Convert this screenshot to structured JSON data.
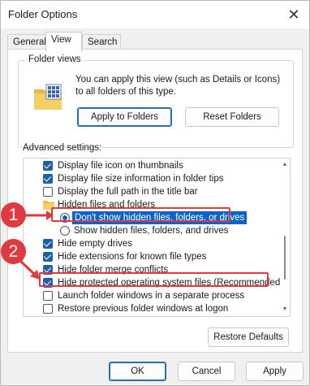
{
  "window": {
    "title": "Folder Options",
    "close_glyph": "✕"
  },
  "tabs": [
    {
      "label": "General",
      "active": false
    },
    {
      "label": "View",
      "active": true
    },
    {
      "label": "Search",
      "active": false
    }
  ],
  "folder_views": {
    "legend": "Folder views",
    "description": "You can apply this view (such as Details or Icons) to all folders of this type.",
    "apply_label": "Apply to Folders",
    "reset_label": "Reset Folders",
    "icon": "folder-grid-icon"
  },
  "advanced": {
    "label": "Advanced settings:",
    "items": [
      {
        "kind": "checkbox",
        "checked": true,
        "label": "Display file icon on thumbnails"
      },
      {
        "kind": "checkbox",
        "checked": true,
        "label": "Display file size information in folder tips"
      },
      {
        "kind": "checkbox",
        "checked": false,
        "label": "Display the full path in the title bar"
      },
      {
        "kind": "folder",
        "label": "Hidden files and folders"
      },
      {
        "kind": "radio",
        "checked": true,
        "label": "Don't show hidden files, folders, or drives"
      },
      {
        "kind": "radio",
        "checked": false,
        "label": "Show hidden files, folders, and drives"
      },
      {
        "kind": "checkbox",
        "checked": true,
        "label": "Hide empty drives"
      },
      {
        "kind": "checkbox",
        "checked": true,
        "label": "Hide extensions for known file types"
      },
      {
        "kind": "checkbox",
        "checked": true,
        "label": "Hide folder merge conflicts"
      },
      {
        "kind": "checkbox",
        "checked": true,
        "label": "Hide protected operating system files (Recommended)"
      },
      {
        "kind": "checkbox",
        "checked": false,
        "label": "Launch folder windows in a separate process"
      },
      {
        "kind": "checkbox",
        "checked": false,
        "label": "Restore previous folder windows at logon"
      }
    ]
  },
  "restore_defaults_label": "Restore Defaults",
  "footer": {
    "ok": "OK",
    "cancel": "Cancel",
    "apply": "Apply"
  },
  "annotations": {
    "badge_1": "1",
    "badge_2": "2"
  },
  "colors": {
    "accent": "#1c5fae",
    "selection": "#0a64c8",
    "callout": "#e0393f"
  }
}
